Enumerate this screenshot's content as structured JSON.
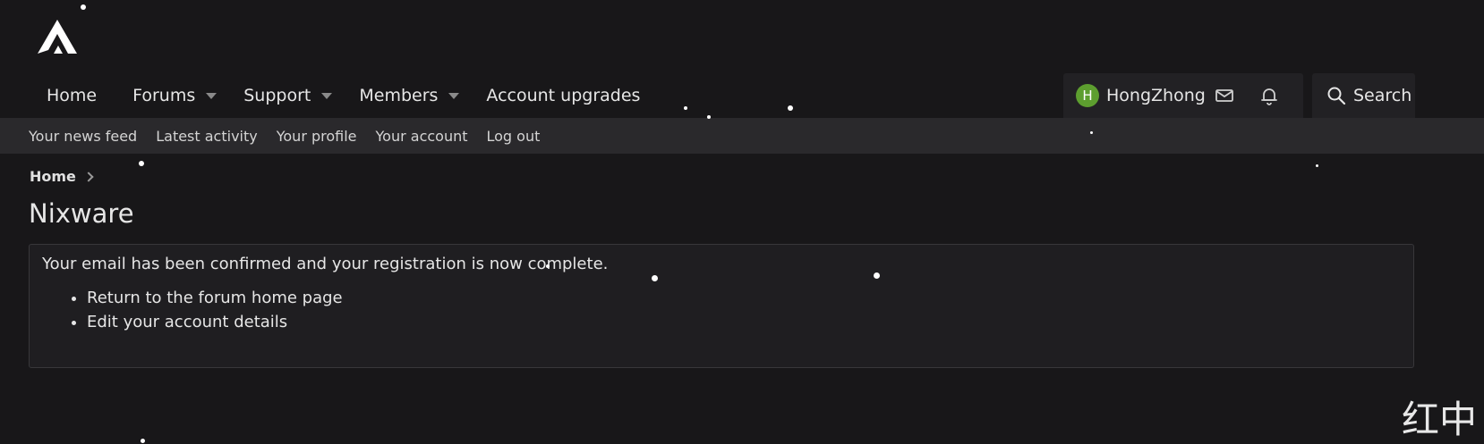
{
  "header": {
    "logo_icon": "site-logo-icon"
  },
  "nav": {
    "tabs": [
      {
        "label": "Home",
        "dropdown": false
      },
      {
        "label": "Forums",
        "dropdown": true
      },
      {
        "label": "Support",
        "dropdown": true
      },
      {
        "label": "Members",
        "dropdown": true
      },
      {
        "label": "Account upgrades",
        "dropdown": false
      }
    ],
    "user": {
      "avatar_letter": "H",
      "name": "HongZhong",
      "avatar_color": "#5d9e2f"
    },
    "icons": [
      "mail-icon",
      "bell-icon"
    ],
    "search_label": "Search"
  },
  "subnav": {
    "links": [
      "Your news feed",
      "Latest activity",
      "Your profile",
      "Your account",
      "Log out"
    ]
  },
  "breadcrumb": {
    "home": "Home"
  },
  "page": {
    "title": "Nixware",
    "message": "Your email has been confirmed and your registration is now complete.",
    "links": [
      "Return to the forum home page",
      "Edit your account details"
    ]
  },
  "watermark": "红中",
  "colors": {
    "background": "#181719",
    "subnav": "#2a292c",
    "block": "#1f1e21",
    "accent": "#5d9e2f"
  }
}
